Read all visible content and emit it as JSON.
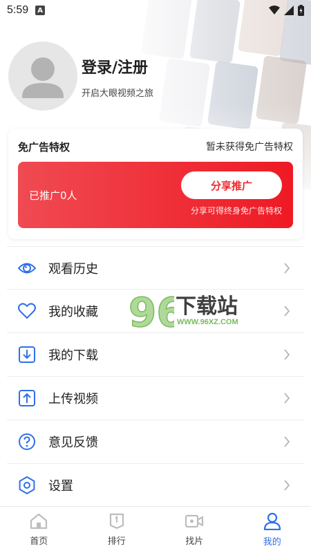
{
  "status_bar": {
    "time": "5:59",
    "notification_glyph": "A"
  },
  "profile": {
    "title": "登录/注册",
    "subtitle": "开启大眼视频之旅"
  },
  "ad_free": {
    "title": "免广告特权",
    "status": "暂未获得免广告特权",
    "promo": {
      "count_text": "已推广0人",
      "share_label": "分享推广",
      "note": "分享可得终身免广告特权"
    }
  },
  "menu": [
    {
      "label": "观看历史",
      "icon": "eye-icon"
    },
    {
      "label": "我的收藏",
      "icon": "heart-icon"
    },
    {
      "label": "我的下载",
      "icon": "download-icon"
    },
    {
      "label": "上传视频",
      "icon": "upload-icon"
    },
    {
      "label": "意见反馈",
      "icon": "feedback-icon"
    },
    {
      "label": "设置",
      "icon": "settings-icon"
    }
  ],
  "watermark": {
    "number": "96",
    "title": "下载站",
    "url": "WWW.96XZ.COM"
  },
  "bottom_nav": [
    {
      "label": "首页",
      "icon": "home-icon",
      "active": false
    },
    {
      "label": "排行",
      "icon": "ranking-icon",
      "active": false
    },
    {
      "label": "找片",
      "icon": "video-icon",
      "active": false
    },
    {
      "label": "我的",
      "icon": "profile-icon",
      "active": true
    }
  ],
  "colors": {
    "accent_red": "#ee1a24",
    "icon_blue": "#2e6fe8",
    "active_tab": "#2e6fe8",
    "watermark_green": "#6db34c"
  }
}
